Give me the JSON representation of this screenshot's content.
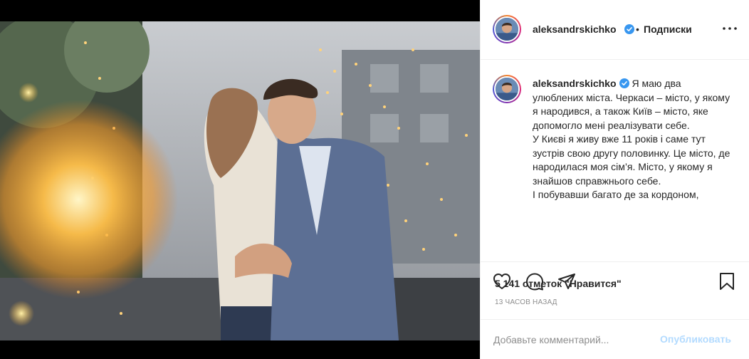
{
  "post": {
    "author": "aleksandrskichko",
    "follow_separator": "•",
    "follow_label": "Подписки",
    "caption": "Я маю два улюблених міста. Черкаси – місто, у якому я народився, а також Київ – місто, яке допомогло мені реалізувати себе.\nУ Києві я живу вже 11 років і саме тут зустрів свою другу половинку. Це місто, де народилася моя сім’я. Місто, у якому я знайшов справжнього себе.\nІ побувавши багато де за кордоном,",
    "likes": "5 141 отметок \"Нравится\"",
    "timestamp": "13 ЧАСОВ НАЗАД"
  },
  "comment": {
    "placeholder": "Добавьте комментарий...",
    "post_label": "Опубликовать"
  },
  "icons": {
    "like": "heart-icon",
    "comment": "comment-icon",
    "share": "paper-plane-icon",
    "save": "bookmark-icon",
    "more": "more-options-icon",
    "verified": "verified-badge-icon"
  },
  "colors": {
    "verified": "#3897f0",
    "post_button_disabled": "#b3dbff",
    "secondary_text": "#8e8e8e"
  }
}
